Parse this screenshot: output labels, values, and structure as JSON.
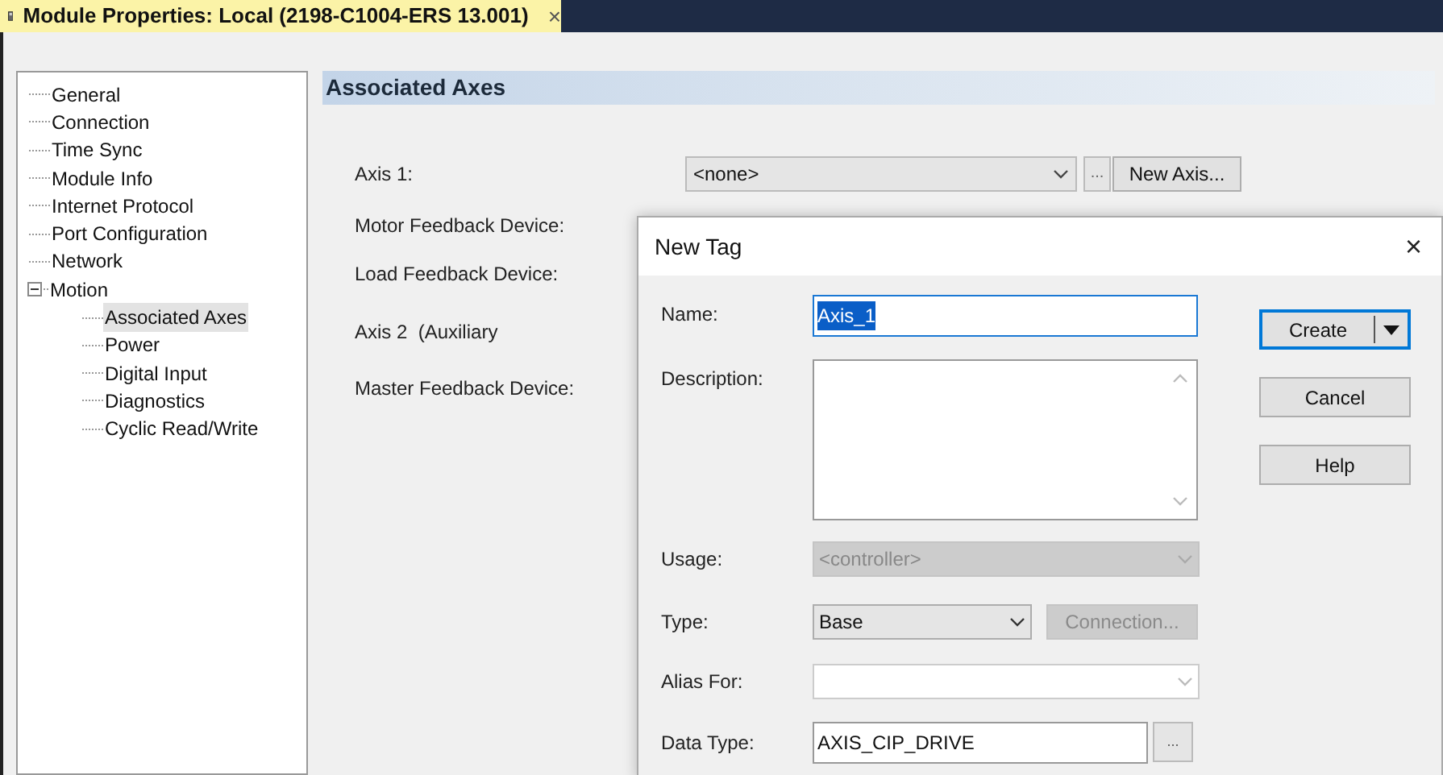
{
  "window": {
    "title": "Module Properties: Local (2198-C1004-ERS 13.001)",
    "close": "×"
  },
  "tree": [
    {
      "label": "General",
      "selected": false
    },
    {
      "label": "Connection",
      "selected": false
    },
    {
      "label": "Time Sync",
      "selected": false
    },
    {
      "label": "Module Info",
      "selected": false
    },
    {
      "label": "Internet Protocol",
      "selected": false
    },
    {
      "label": "Port Configuration",
      "selected": false
    },
    {
      "label": "Network",
      "selected": false
    },
    {
      "label": "Motion",
      "selected": false,
      "expanded": true,
      "children": [
        {
          "label": "Associated Axes",
          "selected": true
        },
        {
          "label": "Power",
          "selected": false
        },
        {
          "label": "Digital Input",
          "selected": false
        },
        {
          "label": "Diagnostics",
          "selected": false
        },
        {
          "label": "Cyclic Read/Write",
          "selected": false
        }
      ]
    }
  ],
  "panel": {
    "header": "Associated Axes",
    "axis1_label": "Axis 1:",
    "axis1_value": "<none>",
    "browse_button": "...",
    "new_axis_button": "New Axis...",
    "labels": [
      "Motor Feedback Device:",
      "Load Feedback Device:",
      "Axis 2  (Auxiliary",
      "Master Feedback Device:"
    ]
  },
  "dialog": {
    "title": "New Tag",
    "close": "×",
    "fields": [
      {
        "kind": "text",
        "label": "Name:",
        "value": "Axis_1",
        "text_selected": true
      },
      {
        "kind": "textarea",
        "label": "Description:"
      },
      {
        "kind": "select",
        "label": "Usage:",
        "value": "<controller>",
        "disabled": true
      },
      {
        "kind": "select_button",
        "label": "Type:",
        "value": "Base",
        "disabled": false,
        "button": "Connection...",
        "button_disabled": true
      },
      {
        "kind": "select",
        "label": "Alias For:",
        "disabled": false
      },
      {
        "kind": "text_browse",
        "label": "Data Type:",
        "value": "AXIS_CIP_DRIVE",
        "button": "..."
      }
    ],
    "buttons": [
      {
        "label": "Create",
        "kind": "split",
        "default": true
      },
      {
        "label": "Cancel",
        "kind": "plain",
        "default": false
      },
      {
        "label": "Help",
        "kind": "plain",
        "default": false
      }
    ]
  }
}
